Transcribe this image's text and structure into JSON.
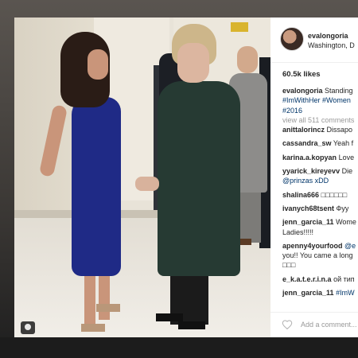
{
  "post": {
    "username": "evalongoria",
    "location": "Washington, D",
    "likes": "60.5k likes",
    "caption": {
      "user": "evalongoria",
      "text": "Standing",
      "tags_line1": "#ImWithHer #Women",
      "tags_line2": "#2016"
    },
    "view_all": "view all 511 comments",
    "comments": [
      {
        "user": "anittalorincz",
        "text": "Dissapo"
      },
      {
        "user": "cassandra_sw",
        "text": "Yeah f"
      },
      {
        "user": "karina.a.kopyan",
        "text": "Love"
      },
      {
        "user": "yyarick_kireyevv",
        "text": "Die",
        "line2": "@prinzas xDD"
      },
      {
        "user": "shalina666",
        "text": "□□□□□□"
      },
      {
        "user": "ivanych68tsent",
        "text": "Фуу"
      },
      {
        "user": "jenn_garcia_11",
        "text": "Wome",
        "line2": "Ladies!!!!!"
      },
      {
        "user": "apenny4yourfood",
        "text": "@e",
        "line2": "you!! You came a long",
        "line3": "□□□"
      },
      {
        "user": "e_k.a.t.e.r.i.n.a",
        "text": "ой тип"
      },
      {
        "user": "jenn_garcia_11",
        "text": "#ImW"
      }
    ],
    "add_comment_placeholder": "Add a comment..."
  },
  "icons": {
    "heart": "heart-outline-icon",
    "profile_button": "person-icon"
  },
  "colors": {
    "tag_blue": "#003569",
    "text": "#262626",
    "muted": "#999999"
  }
}
